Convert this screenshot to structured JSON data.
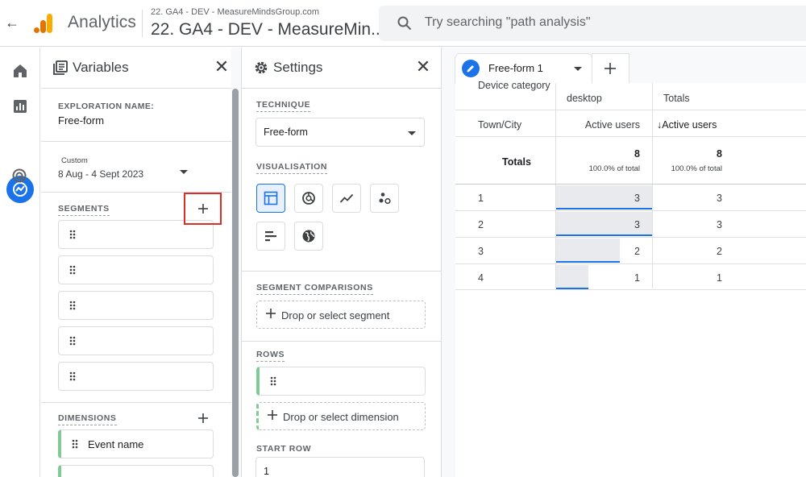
{
  "header": {
    "app_name": "Analytics",
    "property_small": "22. GA4 - DEV - MeasureMindsGroup.com",
    "property_big": "22. GA4 - DEV - MeasureMin...",
    "search_placeholder": "Try searching \"path analysis\""
  },
  "colors": {
    "accent": "#1a73e8",
    "highlight": "#d93025",
    "green_accent": "#81c995",
    "logo_orange": "#f9ab00",
    "logo_dark_orange": "#e37400"
  },
  "nav": {
    "items": [
      "home-icon",
      "reports-icon",
      "explore-icon",
      "advertising-icon"
    ],
    "active": "explore-icon"
  },
  "variables": {
    "title": "Variables",
    "exploration_label": "EXPLORATION NAME:",
    "exploration_name": "Free-form",
    "date_custom": "Custom",
    "date_range": "8 Aug - 4 Sept 2023",
    "segments_label": "SEGMENTS",
    "segments": [
      "",
      "",
      "",
      "",
      ""
    ],
    "dimensions_label": "DIMENSIONS",
    "dimensions": [
      "Event name"
    ]
  },
  "settings": {
    "title": "Settings",
    "technique_label": "TECHNIQUE",
    "technique_value": "Free-form",
    "visualisation_label": "VISUALISATION",
    "viz_types": [
      "table-icon",
      "donut-icon",
      "line-icon",
      "scatter-icon",
      "bar-icon",
      "geo-icon"
    ],
    "segment_comparisons_label": "SEGMENT COMPARISONS",
    "segment_drop": "Drop or select segment",
    "rows_label": "ROWS",
    "row_chips": [
      ""
    ],
    "dimension_drop": "Drop or select dimension",
    "start_row_label": "START ROW",
    "start_row_value": "1"
  },
  "tab": {
    "label": "Free-form 1"
  },
  "table": {
    "dim_header_1": "Device category",
    "col_header_1": "desktop",
    "col_header_2": "Totals",
    "dim_header_2": "Town/City",
    "metric_1": "Active users",
    "metric_2": "↓Active users",
    "totals_label": "Totals",
    "totals_value_1": "8",
    "totals_pct_1": "100.0% of total",
    "totals_value_2": "8",
    "totals_pct_2": "100.0% of total",
    "rows": [
      {
        "index": "1",
        "v1": "3",
        "v2": "3",
        "fraction": 1.0
      },
      {
        "index": "2",
        "v1": "3",
        "v2": "3",
        "fraction": 1.0
      },
      {
        "index": "3",
        "v1": "2",
        "v2": "2",
        "fraction": 0.667
      },
      {
        "index": "4",
        "v1": "1",
        "v2": "1",
        "fraction": 0.333
      }
    ]
  }
}
